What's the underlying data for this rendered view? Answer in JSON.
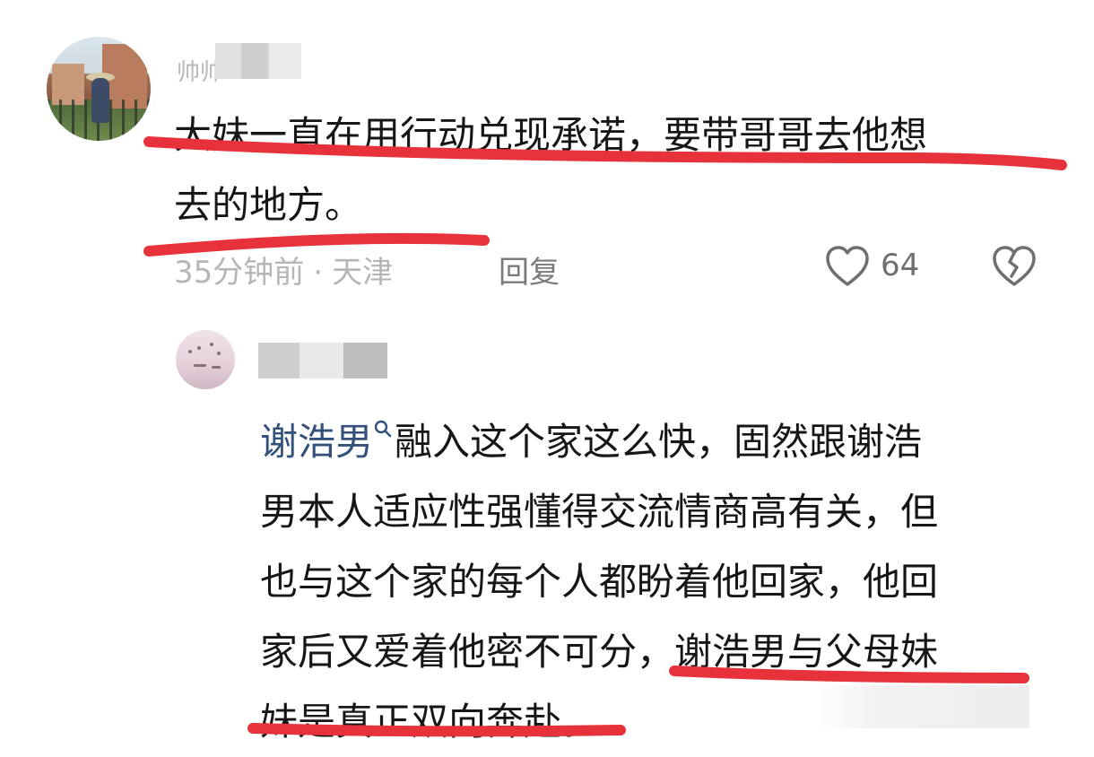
{
  "comment_1": {
    "username": "帅帅",
    "lines": [
      "大妹一直在用行动兑现承诺，要带哥哥去他想",
      "去的地方。"
    ],
    "time": "35分钟前",
    "separator": "·",
    "location": "天津",
    "reply_label": "回复",
    "like_count": "64",
    "icons": {
      "like": "heart-outline-icon",
      "dislike": "broken-heart-icon"
    }
  },
  "comment_2": {
    "mention": "谢浩男",
    "lines": [
      "融入这个家这么快，固然跟谢浩",
      "男本人适应性强懂得交流情商高有关，但",
      "也与这个家的每个人都盼着他回家，他回",
      "家后又爱着他密不可分，谢浩男与父母妹",
      "妹是真正双向奔赴。"
    ],
    "icons": {
      "mention_search": "search-icon"
    }
  },
  "colors": {
    "underline": "#e8323b",
    "mention": "#33517a",
    "meta": "#b6b6b6",
    "text": "#161616"
  }
}
